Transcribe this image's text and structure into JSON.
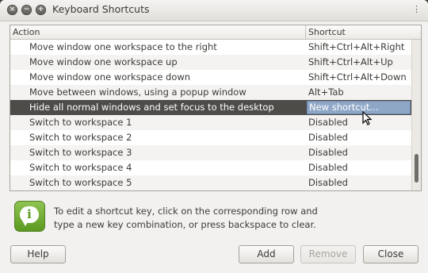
{
  "window": {
    "title": "Keyboard Shortcuts"
  },
  "table": {
    "headers": {
      "action": "Action",
      "shortcut": "Shortcut"
    },
    "rows": [
      {
        "action": "Move window one workspace to the right",
        "shortcut": "Shift+Ctrl+Alt+Right",
        "selected": false
      },
      {
        "action": "Move window one workspace up",
        "shortcut": "Shift+Ctrl+Alt+Up",
        "selected": false
      },
      {
        "action": "Move window one workspace down",
        "shortcut": "Shift+Ctrl+Alt+Down",
        "selected": false
      },
      {
        "action": "Move between windows, using a popup window",
        "shortcut": "Alt+Tab",
        "selected": false
      },
      {
        "action": "Hide all normal windows and set focus to the desktop",
        "shortcut": "New shortcut...",
        "selected": true
      },
      {
        "action": "Switch to workspace 1",
        "shortcut": "Disabled",
        "selected": false
      },
      {
        "action": "Switch to workspace 2",
        "shortcut": "Disabled",
        "selected": false
      },
      {
        "action": "Switch to workspace 3",
        "shortcut": "Disabled",
        "selected": false
      },
      {
        "action": "Switch to workspace 4",
        "shortcut": "Disabled",
        "selected": false
      },
      {
        "action": "Switch to workspace 5",
        "shortcut": "Disabled",
        "selected": false
      }
    ]
  },
  "info": {
    "icon": "info-icon",
    "text": "To edit a shortcut key, click on the corresponding row and type a new key combination, or press backspace to clear."
  },
  "buttons": {
    "help": "Help",
    "add": "Add",
    "remove": "Remove",
    "close": "Close"
  },
  "colors": {
    "selected_row": "#4d4c48",
    "editing_cell": "#8fa7c7",
    "info_green": "#6aa22a"
  }
}
